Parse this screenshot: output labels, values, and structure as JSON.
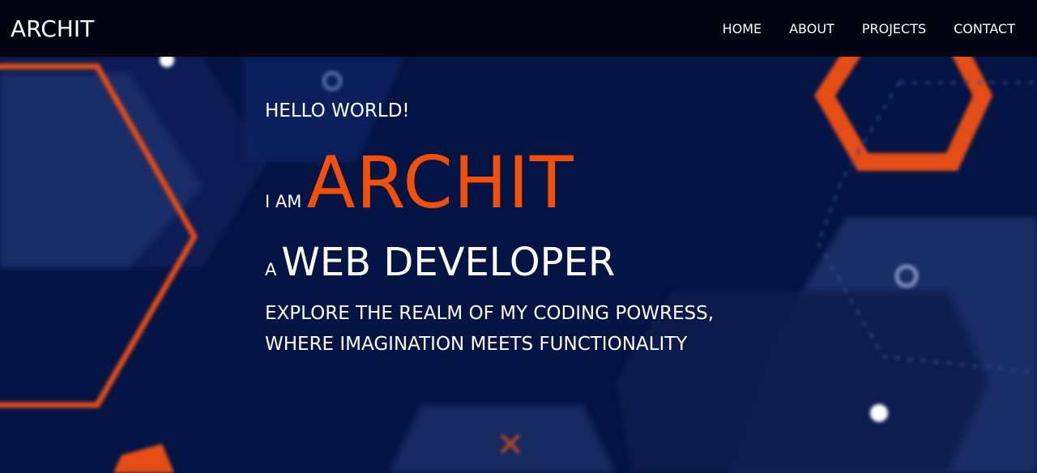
{
  "navbar": {
    "logo": "ARCHIT",
    "links": [
      {
        "label": "HOME"
      },
      {
        "label": "ABOUT"
      },
      {
        "label": "PROJECTS"
      },
      {
        "label": "CONTACT"
      }
    ]
  },
  "hero": {
    "greeting": "HELLO WORLD!",
    "name_prefix": "I AM",
    "name": "ARCHIT",
    "role_prefix": "A",
    "role": "WEB DEVELOPER",
    "tagline_line1": "EXPLORE THE REALM OF MY CODING POWRESS,",
    "tagline_line2": "WHERE IMAGINATION MEETS FUNCTIONALITY"
  },
  "colors": {
    "background": "#031445",
    "navbar": "#020511",
    "accent": "#f24f0b",
    "text": "#ffffff"
  }
}
